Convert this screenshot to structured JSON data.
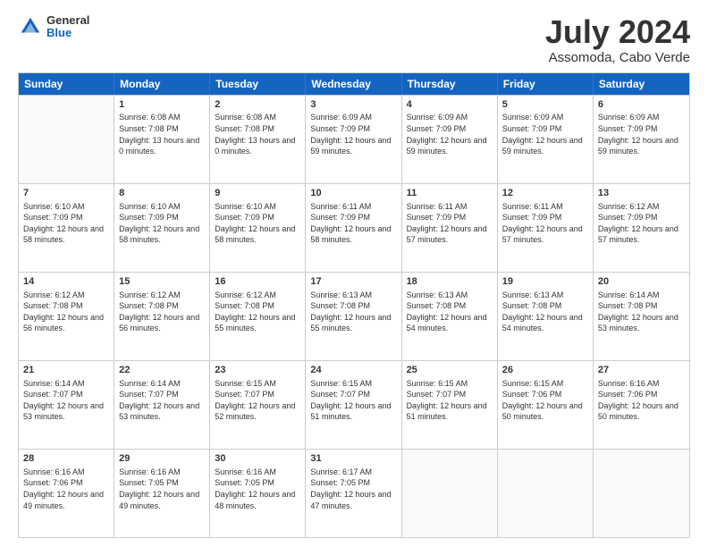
{
  "header": {
    "logo_general": "General",
    "logo_blue": "Blue",
    "main_title": "July 2024",
    "subtitle": "Assomoda, Cabo Verde"
  },
  "days_of_week": [
    "Sunday",
    "Monday",
    "Tuesday",
    "Wednesday",
    "Thursday",
    "Friday",
    "Saturday"
  ],
  "weeks": [
    [
      {
        "num": "",
        "sunrise": "",
        "sunset": "",
        "daylight": "",
        "empty": true
      },
      {
        "num": "1",
        "sunrise": "Sunrise: 6:08 AM",
        "sunset": "Sunset: 7:08 PM",
        "daylight": "Daylight: 13 hours and 0 minutes."
      },
      {
        "num": "2",
        "sunrise": "Sunrise: 6:08 AM",
        "sunset": "Sunset: 7:08 PM",
        "daylight": "Daylight: 13 hours and 0 minutes."
      },
      {
        "num": "3",
        "sunrise": "Sunrise: 6:09 AM",
        "sunset": "Sunset: 7:09 PM",
        "daylight": "Daylight: 12 hours and 59 minutes."
      },
      {
        "num": "4",
        "sunrise": "Sunrise: 6:09 AM",
        "sunset": "Sunset: 7:09 PM",
        "daylight": "Daylight: 12 hours and 59 minutes."
      },
      {
        "num": "5",
        "sunrise": "Sunrise: 6:09 AM",
        "sunset": "Sunset: 7:09 PM",
        "daylight": "Daylight: 12 hours and 59 minutes."
      },
      {
        "num": "6",
        "sunrise": "Sunrise: 6:09 AM",
        "sunset": "Sunset: 7:09 PM",
        "daylight": "Daylight: 12 hours and 59 minutes."
      }
    ],
    [
      {
        "num": "7",
        "sunrise": "Sunrise: 6:10 AM",
        "sunset": "Sunset: 7:09 PM",
        "daylight": "Daylight: 12 hours and 58 minutes."
      },
      {
        "num": "8",
        "sunrise": "Sunrise: 6:10 AM",
        "sunset": "Sunset: 7:09 PM",
        "daylight": "Daylight: 12 hours and 58 minutes."
      },
      {
        "num": "9",
        "sunrise": "Sunrise: 6:10 AM",
        "sunset": "Sunset: 7:09 PM",
        "daylight": "Daylight: 12 hours and 58 minutes."
      },
      {
        "num": "10",
        "sunrise": "Sunrise: 6:11 AM",
        "sunset": "Sunset: 7:09 PM",
        "daylight": "Daylight: 12 hours and 58 minutes."
      },
      {
        "num": "11",
        "sunrise": "Sunrise: 6:11 AM",
        "sunset": "Sunset: 7:09 PM",
        "daylight": "Daylight: 12 hours and 57 minutes."
      },
      {
        "num": "12",
        "sunrise": "Sunrise: 6:11 AM",
        "sunset": "Sunset: 7:09 PM",
        "daylight": "Daylight: 12 hours and 57 minutes."
      },
      {
        "num": "13",
        "sunrise": "Sunrise: 6:12 AM",
        "sunset": "Sunset: 7:09 PM",
        "daylight": "Daylight: 12 hours and 57 minutes."
      }
    ],
    [
      {
        "num": "14",
        "sunrise": "Sunrise: 6:12 AM",
        "sunset": "Sunset: 7:08 PM",
        "daylight": "Daylight: 12 hours and 56 minutes."
      },
      {
        "num": "15",
        "sunrise": "Sunrise: 6:12 AM",
        "sunset": "Sunset: 7:08 PM",
        "daylight": "Daylight: 12 hours and 56 minutes."
      },
      {
        "num": "16",
        "sunrise": "Sunrise: 6:12 AM",
        "sunset": "Sunset: 7:08 PM",
        "daylight": "Daylight: 12 hours and 55 minutes."
      },
      {
        "num": "17",
        "sunrise": "Sunrise: 6:13 AM",
        "sunset": "Sunset: 7:08 PM",
        "daylight": "Daylight: 12 hours and 55 minutes."
      },
      {
        "num": "18",
        "sunrise": "Sunrise: 6:13 AM",
        "sunset": "Sunset: 7:08 PM",
        "daylight": "Daylight: 12 hours and 54 minutes."
      },
      {
        "num": "19",
        "sunrise": "Sunrise: 6:13 AM",
        "sunset": "Sunset: 7:08 PM",
        "daylight": "Daylight: 12 hours and 54 minutes."
      },
      {
        "num": "20",
        "sunrise": "Sunrise: 6:14 AM",
        "sunset": "Sunset: 7:08 PM",
        "daylight": "Daylight: 12 hours and 53 minutes."
      }
    ],
    [
      {
        "num": "21",
        "sunrise": "Sunrise: 6:14 AM",
        "sunset": "Sunset: 7:07 PM",
        "daylight": "Daylight: 12 hours and 53 minutes."
      },
      {
        "num": "22",
        "sunrise": "Sunrise: 6:14 AM",
        "sunset": "Sunset: 7:07 PM",
        "daylight": "Daylight: 12 hours and 53 minutes."
      },
      {
        "num": "23",
        "sunrise": "Sunrise: 6:15 AM",
        "sunset": "Sunset: 7:07 PM",
        "daylight": "Daylight: 12 hours and 52 minutes."
      },
      {
        "num": "24",
        "sunrise": "Sunrise: 6:15 AM",
        "sunset": "Sunset: 7:07 PM",
        "daylight": "Daylight: 12 hours and 51 minutes."
      },
      {
        "num": "25",
        "sunrise": "Sunrise: 6:15 AM",
        "sunset": "Sunset: 7:07 PM",
        "daylight": "Daylight: 12 hours and 51 minutes."
      },
      {
        "num": "26",
        "sunrise": "Sunrise: 6:15 AM",
        "sunset": "Sunset: 7:06 PM",
        "daylight": "Daylight: 12 hours and 50 minutes."
      },
      {
        "num": "27",
        "sunrise": "Sunrise: 6:16 AM",
        "sunset": "Sunset: 7:06 PM",
        "daylight": "Daylight: 12 hours and 50 minutes."
      }
    ],
    [
      {
        "num": "28",
        "sunrise": "Sunrise: 6:16 AM",
        "sunset": "Sunset: 7:06 PM",
        "daylight": "Daylight: 12 hours and 49 minutes."
      },
      {
        "num": "29",
        "sunrise": "Sunrise: 6:16 AM",
        "sunset": "Sunset: 7:05 PM",
        "daylight": "Daylight: 12 hours and 49 minutes."
      },
      {
        "num": "30",
        "sunrise": "Sunrise: 6:16 AM",
        "sunset": "Sunset: 7:05 PM",
        "daylight": "Daylight: 12 hours and 48 minutes."
      },
      {
        "num": "31",
        "sunrise": "Sunrise: 6:17 AM",
        "sunset": "Sunset: 7:05 PM",
        "daylight": "Daylight: 12 hours and 47 minutes."
      },
      {
        "num": "",
        "sunrise": "",
        "sunset": "",
        "daylight": "",
        "empty": true
      },
      {
        "num": "",
        "sunrise": "",
        "sunset": "",
        "daylight": "",
        "empty": true
      },
      {
        "num": "",
        "sunrise": "",
        "sunset": "",
        "daylight": "",
        "empty": true
      }
    ]
  ]
}
